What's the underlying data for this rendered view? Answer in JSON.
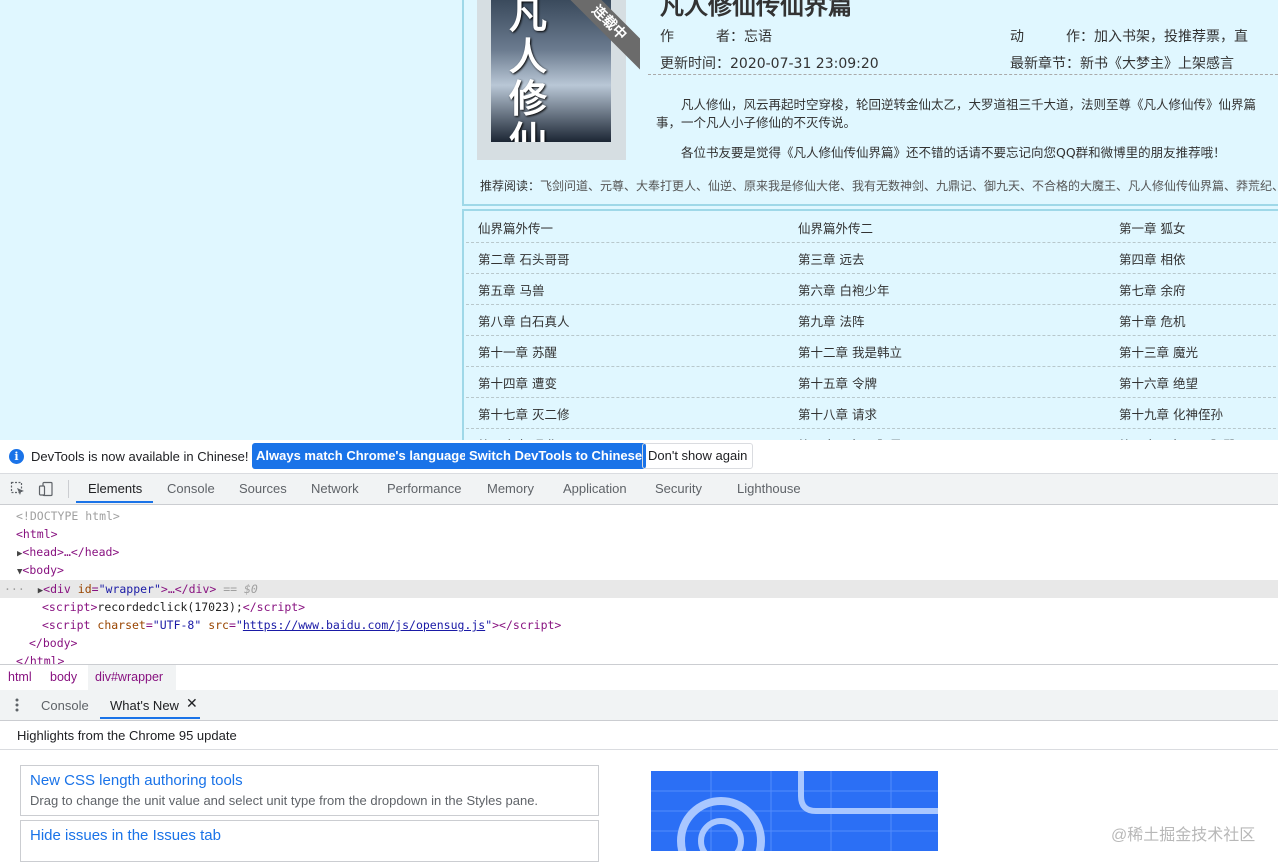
{
  "book": {
    "title": "凡人修仙传仙界篇",
    "cover_title": "凡人修仙",
    "status_ribbon": "连载中",
    "author_label": "作　　　者：",
    "author": "忘语",
    "action_label": "动　　　作：",
    "actions": [
      "加入书架",
      "投推荐票",
      "直"
    ],
    "updated_label": "更新时间：",
    "updated": "2020-07-31 23:09:20",
    "latest_label": "最新章节：",
    "latest": "新书《大梦主》上架感言",
    "intro_1": "凡人修仙，风云再起时空穿梭，轮回逆转金仙太乙，大罗道祖三千大道，法则至尊《凡人修仙传》仙界篇，一个凡人小子修仙的不灭传说。",
    "intro_1a": "凡人修仙，风云再起时空穿梭，轮回逆转金仙太乙，大罗道祖三千大道，法则至尊《凡人修仙传》仙界篇",
    "intro_1b": "事，一个凡人小子修仙的不灭传说。",
    "intro_2": "各位书友要是觉得《凡人修仙传仙界篇》还不错的话请不要忘记向您QQ群和微博里的朋友推荐哦！",
    "rec_label": "推荐阅读：",
    "rec_items": "飞剑问道、元尊、大奉打更人、仙逆、原来我是修仙大佬、我有无数神剑、九鼎记、御九天、不合格的大魔王、凡人修仙传仙界篇、莽荒纪、"
  },
  "chapters": [
    [
      "仙界篇外传一",
      "仙界篇外传二",
      "第一章 狐女"
    ],
    [
      "第二章 石头哥哥",
      "第三章 远去",
      "第四章 相依"
    ],
    [
      "第五章 马兽",
      "第六章 白袍少年",
      "第七章 余府"
    ],
    [
      "第八章 白石真人",
      "第九章 法阵",
      "第十章 危机"
    ],
    [
      "第十一章 苏醒",
      "第十二章 我是韩立",
      "第十三章 魔光"
    ],
    [
      "第十四章 遭变",
      "第十五章 令牌",
      "第十六章 绝望"
    ],
    [
      "第十七章 灭二修",
      "第十八章 请求",
      "第十九章 化神侄孙"
    ],
    [
      "第二十章 遇袭",
      "第二十一章 三阳星辰",
      "第二十二章 日三阳殿"
    ]
  ],
  "infobar": {
    "message": "DevTools is now available in Chinese!",
    "btn_match": "Always match Chrome's language",
    "btn_switch": "Switch DevTools to Chinese",
    "btn_dismiss": "Don't show again"
  },
  "devtools_tabs": [
    "Elements",
    "Console",
    "Sources",
    "Network",
    "Performance",
    "Memory",
    "Application",
    "Security",
    "Lighthouse"
  ],
  "dom": {
    "doctype": "<!DOCTYPE html>",
    "html_open": "<html>",
    "head": "<head>…</head>",
    "body_open": "<body>",
    "div_tag": "div",
    "div_attr": "id",
    "div_val": "\"wrapper\"",
    "div_rest": ">…</div>",
    "sel_marker": "== $0",
    "script1": "recordedclick(17023);",
    "script2_charset_val": "\"UTF-8\"",
    "script2_src": "https://www.baidu.com/js/opensug.js",
    "body_close": "</body>",
    "html_close": "</html>"
  },
  "breadcrumbs": [
    "html",
    "body",
    "div#wrapper"
  ],
  "drawer_tabs": [
    "Console",
    "What's New"
  ],
  "whats_new": {
    "heading": "Highlights from the Chrome 95 update",
    "items": [
      {
        "title": "New CSS length authoring tools",
        "desc": "Drag to change the unit value and select unit type from the dropdown in the Styles pane."
      },
      {
        "title": "Hide issues in the Issues tab",
        "desc": ""
      }
    ]
  },
  "watermark": "@稀土掘金技术社区",
  "colors": {
    "accent": "#1a73e8",
    "page_bg": "#e0f7ff",
    "border": "#9fd8e8"
  }
}
